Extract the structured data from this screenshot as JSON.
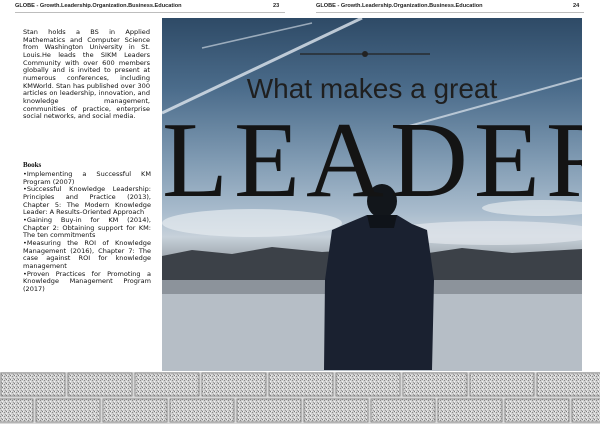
{
  "left_page": {
    "header": "GLOBE - Growth.Leadership.Organization.Business.Education",
    "page_number": "23",
    "bio": "Stan holds a BS in Applied Mathematics and Computer Science from Washington University in St. Louis.He leads the SIKM Leaders Community with over 600 members globally and is invited to present at numerous conferences, including KMWorld. Stan has published over 300 articles on leadership, innovation, and knowledge management, communities of practice, enterprise social networks, and social media.",
    "books_heading": "Books",
    "books": [
      "•Implementing a Successful KM Program (2007)",
      "•Successful Knowledge Leadership: Principles and Practice (2013), Chapter 5: The Modern Knowledge Leader: A Results-Oriented Approach",
      "•Gaining Buy-in for KM (2014), Chapter 2: Obtaining support for KM: The ten commitments",
      "•Measuring the ROI of Knowledge Management (2016), Chapter 7: The case against ROI for knowledge management",
      "•Proven Practices for Promoting a Knowledge Management Program (2017)"
    ]
  },
  "right_page": {
    "header": "GLOBE - Growth.Leadership.Organization.Business.Education",
    "page_number": "24",
    "image_subtitle": "What makes a great",
    "image_title": "LEADER"
  },
  "colors": {
    "text": "#111111",
    "rule": "#bdbdbd",
    "footer": "#d9d9d9"
  }
}
